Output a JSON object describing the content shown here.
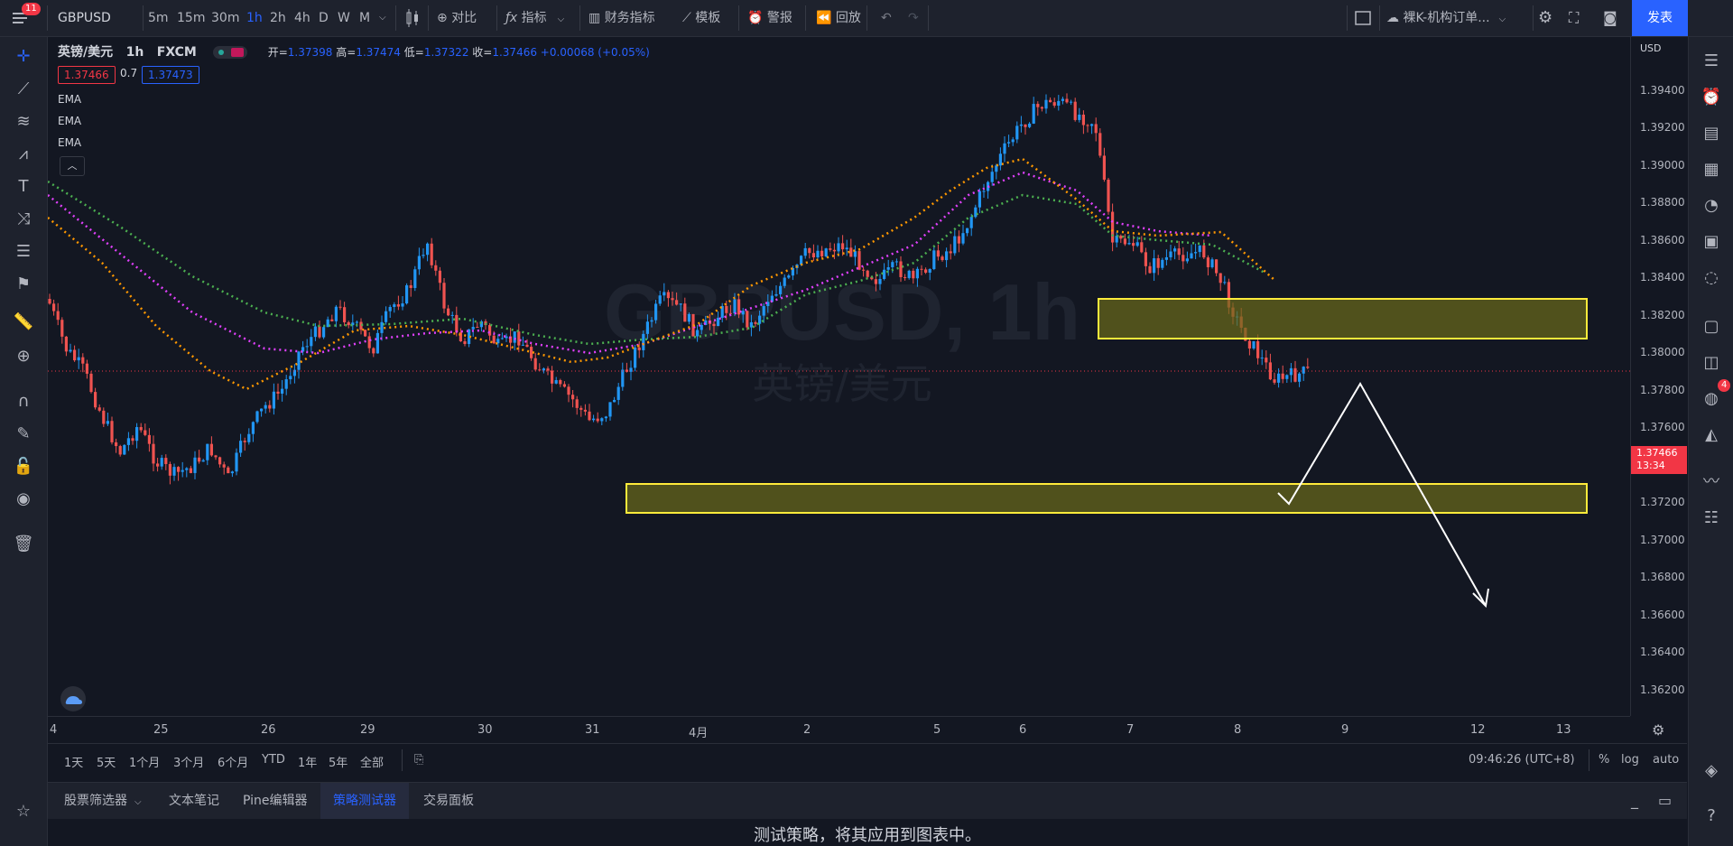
{
  "topbar": {
    "badge": "11",
    "symbol": "GBPUSD",
    "intervals": [
      "5m",
      "15m",
      "30m",
      "1h",
      "2h",
      "4h",
      "D",
      "W",
      "M"
    ],
    "active_interval": "1h",
    "compare": "对比",
    "indicators": "指标",
    "financials": "财务指标",
    "templates": "模板",
    "alerts": "警报",
    "replay": "回放",
    "layout_name": "裸K-机构订单...",
    "publish": "发表"
  },
  "legend": {
    "title": "英镑/美元",
    "interval": "1h",
    "source": "FXCM",
    "open_label": "开=",
    "open": "1.37398",
    "high_label": "高=",
    "high": "1.37474",
    "low_label": "低=",
    "low": "1.37322",
    "close_label": "收=",
    "close": "1.37466",
    "change": "+0.00068 (+0.05%)",
    "bid": "1.37466",
    "spread": "0.7",
    "ask": "1.37473",
    "indicators": [
      "EMA",
      "EMA",
      "EMA"
    ]
  },
  "watermark": {
    "symbol": "GBPUSD, 1h",
    "name": "英镑/美元"
  },
  "price_axis": {
    "currency": "USD",
    "labels": [
      "1.39400",
      "1.39200",
      "1.39000",
      "1.38800",
      "1.38600",
      "1.38400",
      "1.38200",
      "1.38000",
      "1.37800",
      "1.37600",
      "1.37200",
      "1.37000",
      "1.36800",
      "1.36600",
      "1.36400",
      "1.36200"
    ],
    "current_price": "1.37466",
    "countdown": "13:34"
  },
  "time_axis": {
    "labels": [
      "4",
      "25",
      "26",
      "29",
      "30",
      "31",
      "4月",
      "2",
      "5",
      "6",
      "7",
      "8",
      "9",
      "12",
      "13"
    ]
  },
  "range_bar": {
    "ranges": [
      "1天",
      "5天",
      "1个月",
      "3个月",
      "6个月",
      "YTD",
      "1年",
      "5年",
      "全部"
    ],
    "clock": "09:46:26 (UTC+8)",
    "percent": "%",
    "log": "log",
    "auto": "auto"
  },
  "bottom_tabs": {
    "tabs": [
      "股票筛选器",
      "文本笔记",
      "Pine编辑器",
      "策略测试器",
      "交易面板"
    ],
    "active": "策略测试器"
  },
  "bottom_panel": {
    "message": "测试策略，将其应用到图表中。"
  },
  "rightbar": {
    "notif_badge": "4"
  },
  "colors": {
    "background": "#131722",
    "up": "#2196f3",
    "down": "#ef5350",
    "ema_fast": "#ff9800",
    "ema_mid": "#e040fb",
    "ema_slow": "#4caf50",
    "zone_border": "#ffeb3b",
    "zone_fill": "#6b6b1a",
    "price_tag": "#f23645",
    "accent": "#2962ff"
  }
}
